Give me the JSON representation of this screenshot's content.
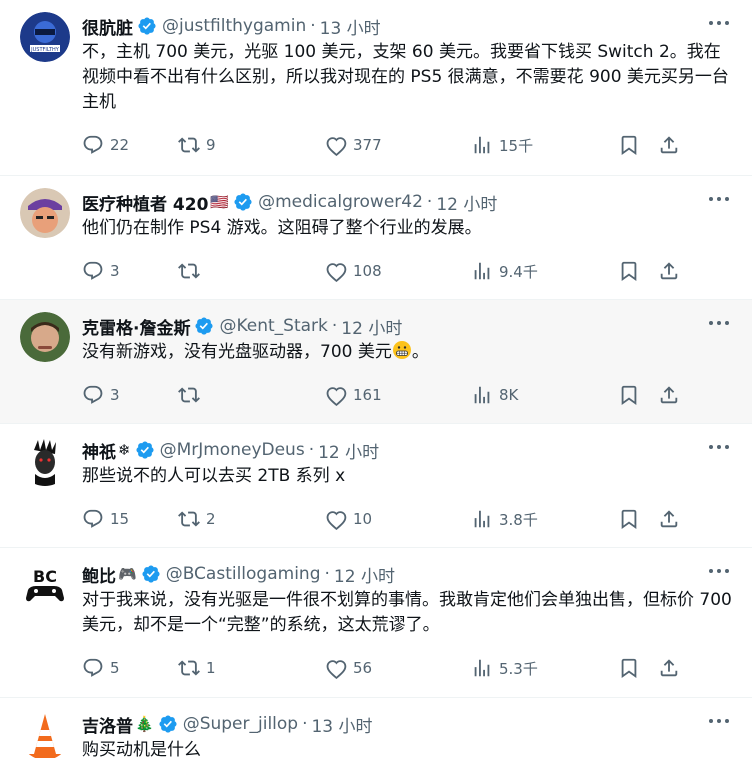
{
  "tweets": [
    {
      "name": "很肮脏",
      "emoji": "",
      "handle": "@justfilthygamin",
      "time": "13 小时",
      "text": "不，主机 700 美元，光驱 100 美元，支架 60 美元。我要省下钱买 Switch 2。我在视频中看不出有什么区别，所以我对现在的 PS5 很满意，不需要花 900 美元买另一台主机",
      "replies": "22",
      "retweets": "9",
      "likes": "377",
      "views": "15千",
      "avatar_color": "#1d3a8a"
    },
    {
      "name": "医疗种植者 420",
      "emoji": "🇺🇸",
      "handle": "@medicalgrower42",
      "time": "12 小时",
      "text": "他们仍在制作 PS4 游戏。这阻碍了整个行业的发展。",
      "replies": "3",
      "retweets": "",
      "likes": "108",
      "views": "9.4千",
      "avatar_color": "#6b3fa0"
    },
    {
      "name": "克雷格·詹金斯",
      "emoji": "",
      "handle": "@Kent_Stark",
      "time": "12 小时",
      "text": "没有新游戏，没有光盘驱动器，700 美元",
      "text_suffix": "。",
      "replies": "3",
      "retweets": "",
      "likes": "161",
      "views": "8K",
      "avatar_color": "#4a6a3a"
    },
    {
      "name": "神祇",
      "emoji": "❄",
      "handle": "@MrJmoneyDeus",
      "time": "12 小时",
      "text": "那些说不的人可以去买 2TB 系列 x",
      "replies": "15",
      "retweets": "2",
      "likes": "10",
      "views": "3.8千",
      "avatar_color": "#222222"
    },
    {
      "name": "鲍比",
      "emoji": "🎮",
      "handle": "@BCastillogaming",
      "time": "12 小时",
      "text": "对于我来说，没有光驱是一件很不划算的事情。我敢肯定他们会单独出售，但标价 700 美元，却不是一个“完整”的系统，这太荒谬了。",
      "replies": "5",
      "retweets": "1",
      "likes": "56",
      "views": "5.3千",
      "avatar_color": "#ffffff"
    },
    {
      "name": "吉洛普",
      "emoji": "🎄",
      "handle": "@Super_jillop",
      "time": "13 小时",
      "text": "购买动机是什么",
      "replies": "",
      "retweets": "",
      "likes": "",
      "views": "",
      "avatar_color": "#ffffff"
    }
  ],
  "colors": {
    "verified": "#1d9bf0",
    "muted": "#536471",
    "highlight_bg": "#f7f7f7"
  },
  "icons": [
    "verified-badge-icon",
    "more-icon",
    "reply-icon",
    "retweet-icon",
    "like-icon",
    "views-icon",
    "bookmark-icon",
    "share-icon"
  ]
}
